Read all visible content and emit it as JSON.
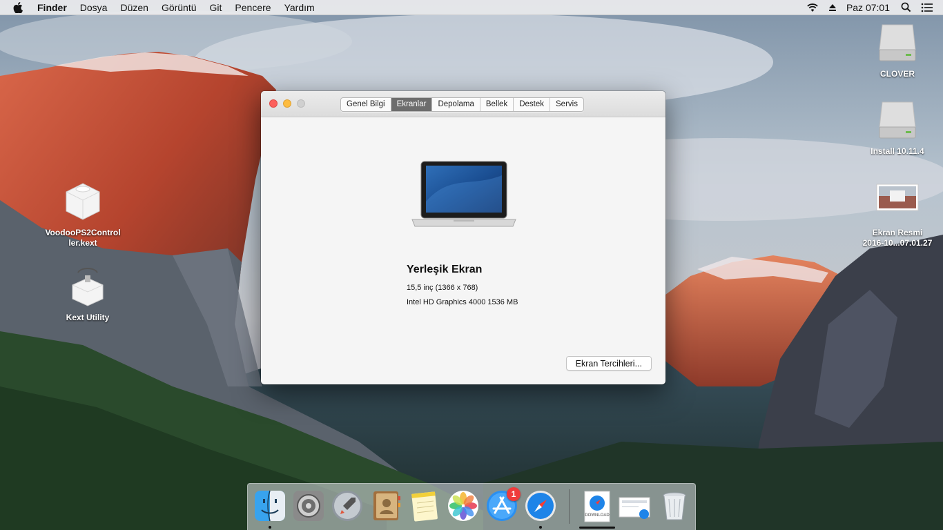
{
  "menubar": {
    "app_name": "Finder",
    "items": [
      "Dosya",
      "Düzen",
      "Görüntü",
      "Git",
      "Pencere",
      "Yardım"
    ],
    "clock": "Paz 07:01",
    "icons": [
      "apple-logo",
      "wifi-icon",
      "eject-icon",
      "spotlight-search-icon",
      "notification-center-icon"
    ]
  },
  "desktop": {
    "left_icons": [
      {
        "label": "VoodooPS2Controller.kext",
        "label_line1": "VoodooPS2Control",
        "label_line2": "ler.kext",
        "icon": "kext-bundle-icon"
      },
      {
        "label": "Kext Utility",
        "icon": "kext-utility-icon"
      }
    ],
    "right_icons": [
      {
        "label": "CLOVER",
        "icon": "external-drive-icon"
      },
      {
        "label": "Install 10.11.4",
        "icon": "external-drive-icon"
      },
      {
        "label_line1": "Ekran Resmi",
        "label_line2": "2016-10...07.01.27",
        "icon": "screenshot-file-icon"
      }
    ]
  },
  "window": {
    "tabs": [
      "Genel Bilgi",
      "Ekranlar",
      "Depolama",
      "Bellek",
      "Destek",
      "Servis"
    ],
    "active_tab": "Ekranlar",
    "display_name": "Yerleşik Ekran",
    "display_size": "15,5 inç (1366 x 768)",
    "display_gpu": "Intel HD Graphics 4000 1536 MB",
    "prefs_button": "Ekran Tercihleri..."
  },
  "dock": {
    "apps": [
      {
        "name": "Finder",
        "icon": "finder-icon",
        "running": true
      },
      {
        "name": "System Preferences",
        "icon": "system-preferences-icon",
        "running": false
      },
      {
        "name": "Launchpad",
        "icon": "launchpad-icon",
        "running": false
      },
      {
        "name": "Contacts",
        "icon": "contacts-icon",
        "running": false
      },
      {
        "name": "Notes",
        "icon": "notes-icon",
        "running": false
      },
      {
        "name": "Photos",
        "icon": "photos-icon",
        "running": false
      },
      {
        "name": "App Store",
        "icon": "app-store-icon",
        "running": false,
        "badge": "1"
      },
      {
        "name": "Safari",
        "icon": "safari-icon",
        "running": true
      }
    ],
    "stacks": [
      {
        "icon": "downloads-stack-icon",
        "label": "DOWNLOAD"
      },
      {
        "icon": "document-stack-icon"
      },
      {
        "icon": "trash-icon"
      }
    ]
  }
}
